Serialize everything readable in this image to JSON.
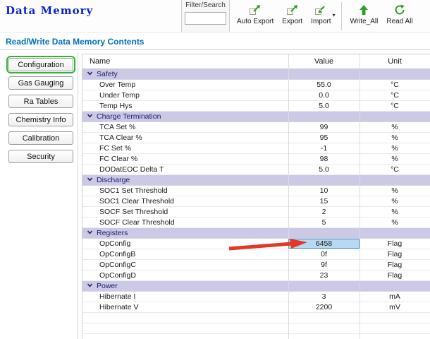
{
  "app": {
    "title": "Data Memory"
  },
  "toolbar": {
    "filter_label": "Filter/Search",
    "filter_value": "",
    "buttons": [
      {
        "label": "Auto Export",
        "icon": "export-icon"
      },
      {
        "label": "Export",
        "icon": "export-icon"
      },
      {
        "label": "Import",
        "icon": "import-icon",
        "has_dropdown": true
      },
      {
        "label": "Write_All",
        "icon": "write-up-arrow-icon"
      },
      {
        "label": "Read All",
        "icon": "refresh-icon"
      }
    ]
  },
  "page": {
    "heading": "Read/Write Data Memory Contents"
  },
  "sidebar": {
    "items": [
      {
        "label": "Configuration",
        "selected": true
      },
      {
        "label": "Gas Gauging",
        "selected": false
      },
      {
        "label": "Ra Tables",
        "selected": false
      },
      {
        "label": "Chemistry Info",
        "selected": false
      },
      {
        "label": "Calibration",
        "selected": false
      },
      {
        "label": "Security",
        "selected": false
      }
    ]
  },
  "table": {
    "columns": [
      "Name",
      "Value",
      "Unit"
    ],
    "sections": [
      {
        "name": "Safety",
        "rows": [
          [
            "Over Temp",
            "55.0",
            "°C"
          ],
          [
            "Under Temp",
            "0.0",
            "°C"
          ],
          [
            "Temp Hys",
            "5.0",
            "°C"
          ]
        ]
      },
      {
        "name": "Charge Termination",
        "rows": [
          [
            "TCA Set %",
            "99",
            "%"
          ],
          [
            "TCA Clear %",
            "95",
            "%"
          ],
          [
            "FC Set %",
            "-1",
            "%"
          ],
          [
            "FC Clear %",
            "98",
            "%"
          ],
          [
            "DODatEOC Delta T",
            "5.0",
            "°C"
          ]
        ]
      },
      {
        "name": "Discharge",
        "rows": [
          [
            "SOC1 Set Threshold",
            "10",
            "%"
          ],
          [
            "SOC1 Clear Threshold",
            "15",
            "%"
          ],
          [
            "SOCF Set Threshold",
            "2",
            "%"
          ],
          [
            "SOCF Clear Threshold",
            "5",
            "%"
          ]
        ]
      },
      {
        "name": "Registers",
        "rows": [
          [
            "OpConfig",
            "6458",
            "Flag"
          ],
          [
            "OpConfigB",
            "0f",
            "Flag"
          ],
          [
            "OpConfigC",
            "9f",
            "Flag"
          ],
          [
            "OpConfigD",
            "23",
            "Flag"
          ]
        ]
      },
      {
        "name": "Power",
        "rows": [
          [
            "Hibernate I",
            "3",
            "mA"
          ],
          [
            "Hibernate V",
            "2200",
            "mV"
          ]
        ]
      }
    ],
    "selected_cell": {
      "section": "Registers",
      "row": "OpConfig",
      "value": "6458"
    }
  },
  "colors": {
    "title_blue": "#0a23cc",
    "heading_blue": "#0070c0",
    "section_bg": "#cbc9e6",
    "section_text": "#1c1c66",
    "selected_cell_bg": "#b8d9f2",
    "selected_cell_border": "#4e94c8",
    "selected_outline_green": "#2fb52f",
    "arrow_red": "#e23825",
    "icon_green": "#2e9e2e"
  }
}
